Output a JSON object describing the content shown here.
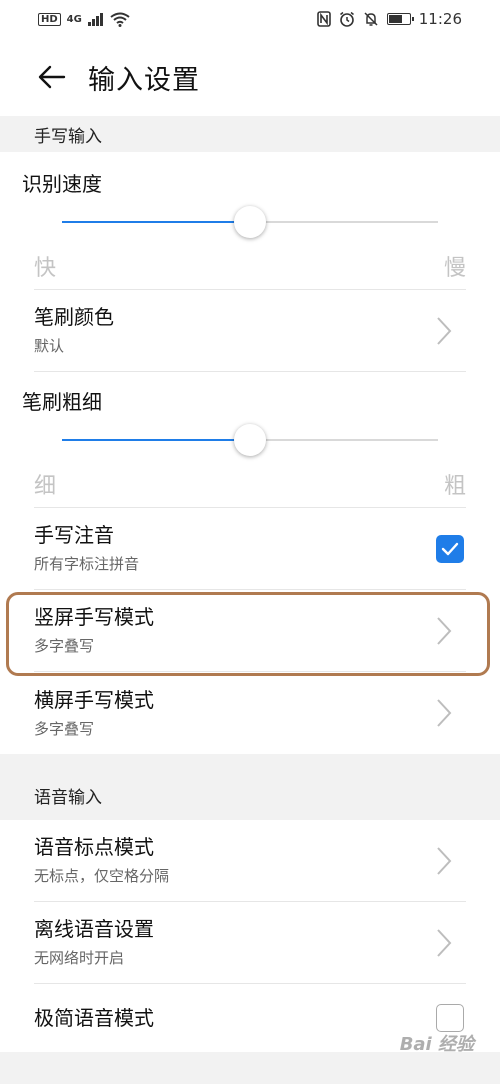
{
  "status_bar": {
    "hd": "HD",
    "network": "4G",
    "time": "11:26"
  },
  "header": {
    "title": "输入设置"
  },
  "handwriting": {
    "section_title": "手写输入",
    "speed": {
      "label": "识别速度",
      "min_label": "快",
      "max_label": "慢",
      "value": 0.5
    },
    "brush_color": {
      "title": "笔刷颜色",
      "subtitle": "默认"
    },
    "brush_width": {
      "label": "笔刷粗细",
      "min_label": "细",
      "max_label": "粗",
      "value": 0.5
    },
    "phonetic": {
      "title": "手写注音",
      "subtitle": "所有字标注拼音",
      "checked": true
    },
    "portrait_mode": {
      "title": "竖屏手写模式",
      "subtitle": "多字叠写"
    },
    "landscape_mode": {
      "title": "横屏手写模式",
      "subtitle": "多字叠写"
    }
  },
  "voice": {
    "section_title": "语音输入",
    "punctuation": {
      "title": "语音标点模式",
      "subtitle": "无标点，仅空格分隔"
    },
    "offline": {
      "title": "离线语音设置",
      "subtitle": "无网络时开启"
    },
    "minimal": {
      "title": "极简语音模式",
      "checked": false
    }
  },
  "watermark": "Bai 经验",
  "colors": {
    "accent": "#1f7de8",
    "highlight_border": "#b07a50",
    "section_bg": "#f2f2f2"
  }
}
